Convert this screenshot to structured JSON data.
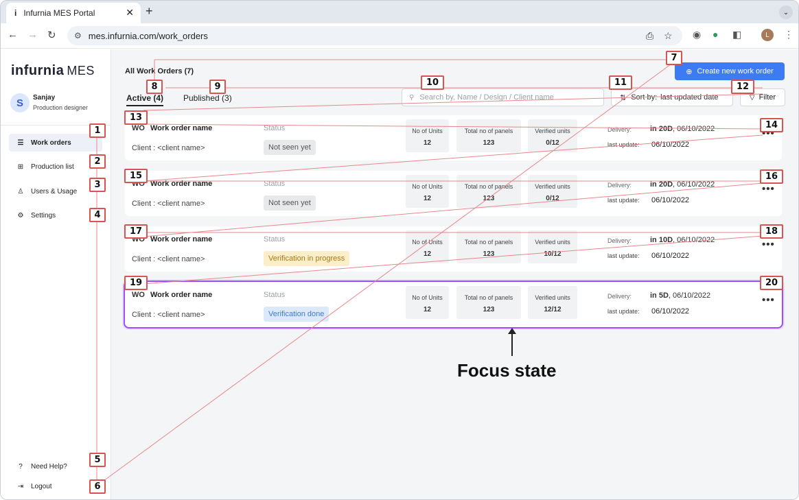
{
  "browser": {
    "tab_title": "Infurnia MES Portal",
    "tab_favicon": "i",
    "url": "mes.infurnia.com/work_orders",
    "profile_initial": "L"
  },
  "sidebar": {
    "logo": "infurnia",
    "logo_suffix": "MES",
    "avatar_initial": "S",
    "user_name": "Sanjay",
    "user_role": "Production designer",
    "items": [
      {
        "label": "Work orders",
        "icon": "list-icon"
      },
      {
        "label": "Production list",
        "icon": "grid-icon"
      },
      {
        "label": "Users & Usage",
        "icon": "user-icon"
      },
      {
        "label": "Settings",
        "icon": "gear-icon"
      }
    ],
    "help_label": "Need Help?",
    "logout_label": "Logout"
  },
  "header": {
    "title": "All Work Orders (7)",
    "create_label": "Create new work order",
    "tab_active": "Active (4)",
    "tab_published": "Published (3)",
    "search_placeholder": "Search by, Name / Design / Client name",
    "sort_prefix": "Sort by:",
    "sort_value": "last updated date",
    "filter_label": "Filter"
  },
  "labels": {
    "status": "Status",
    "units": "No of Units",
    "panels": "Total no of panels",
    "verified": "Verified units",
    "delivery": "Delivery:",
    "last_update": "last update:"
  },
  "orders": [
    {
      "id": "WO",
      "name": "Work order name",
      "client": "Client : <client name>",
      "status": "Not seen yet",
      "units": "12",
      "panels": "123",
      "verified": "0/12",
      "delivery_in": "in 20D",
      "delivery_date": ", 06/10/2022",
      "updated": "06/10/2022"
    },
    {
      "id": "WO",
      "name": "Work order name",
      "client": "Client : <client name>",
      "status": "Not seen yet",
      "units": "12",
      "panels": "123",
      "verified": "0/12",
      "delivery_in": "in 20D",
      "delivery_date": ", 06/10/2022",
      "updated": "06/10/2022"
    },
    {
      "id": "WO",
      "name": "Work order name",
      "client": "Client : <client name>",
      "status": "Verification in progress",
      "units": "12",
      "panels": "123",
      "verified": "10/12",
      "delivery_in": "in 10D",
      "delivery_date": ", 06/10/2022",
      "updated": "06/10/2022"
    },
    {
      "id": "WO",
      "name": "Work order name",
      "client": "Client : <client name>",
      "status": "Verification done",
      "units": "12",
      "panels": "123",
      "verified": "12/12",
      "delivery_in": "in 5D",
      "delivery_date": ", 06/10/2022",
      "updated": "06/10/2022"
    }
  ],
  "annotation": {
    "focus_label": "Focus state",
    "markers": [
      "1",
      "2",
      "3",
      "4",
      "5",
      "6",
      "7",
      "8",
      "9",
      "10",
      "11",
      "12",
      "13",
      "14",
      "15",
      "16",
      "17",
      "18",
      "19",
      "20"
    ]
  },
  "colors": {
    "primary": "#3d7bf5",
    "focus_outline": "#9b4dff",
    "marker_border": "#d9534f"
  }
}
